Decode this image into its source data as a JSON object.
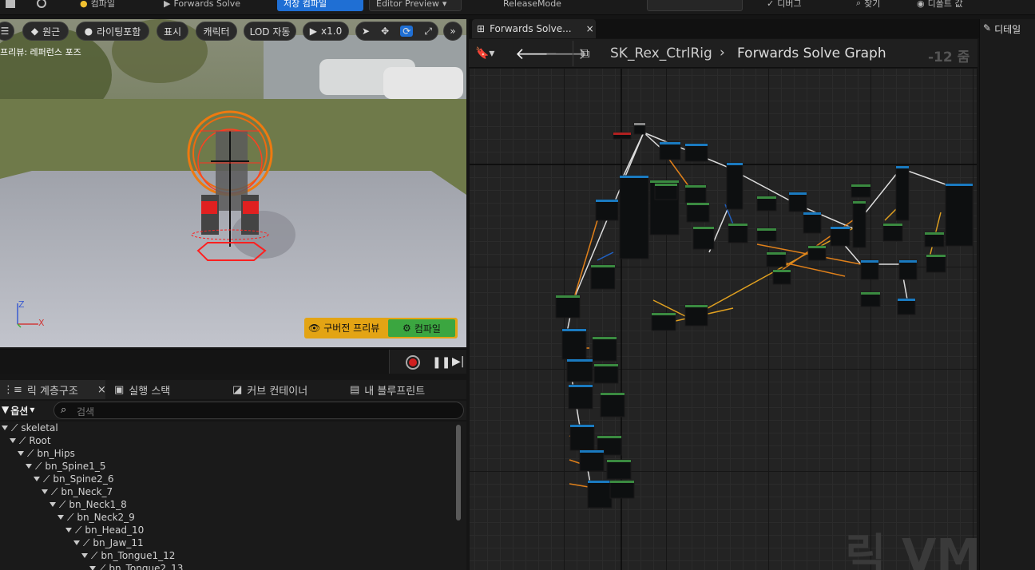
{
  "topbar": {
    "compile_label": "컴파일",
    "forwards_solve_label": "Forwards Solve",
    "save_compile_label": "저장 컴파일",
    "editor_preview_label": "Editor Preview",
    "release_mode_label": "ReleaseMode",
    "find_label": "찾기",
    "default_label": "디폴트 값",
    "debug_label": "디버그"
  },
  "viewport": {
    "toolbar": {
      "perspective_label": "원근",
      "lighting_label": "라이팅포함",
      "show_label": "표시",
      "character_label": "캐릭터",
      "lod_label": "LOD 자동",
      "speed_label": "x1.0"
    },
    "preview_label": "프리뷰: 레퍼런스 포즈",
    "axis_z": "Z",
    "axis_x": "X",
    "stale_preview_label": "구버전 프리뷰",
    "compile_button_label": "컴파일"
  },
  "tabs": {
    "rig_hierarchy": "릭 계층구조",
    "execution_stack": "실행 스택",
    "curve_container": "커브 컨테이너",
    "my_blueprint": "내 블루프린트"
  },
  "search": {
    "options_label": "옵션",
    "placeholder": "검색"
  },
  "tree": [
    {
      "label": "skeletal",
      "depth": 0
    },
    {
      "label": "Root",
      "depth": 1
    },
    {
      "label": "bn_Hips",
      "depth": 2
    },
    {
      "label": "bn_Spine1_5",
      "depth": 3
    },
    {
      "label": "bn_Spine2_6",
      "depth": 4
    },
    {
      "label": "bn_Neck_7",
      "depth": 5
    },
    {
      "label": "bn_Neck1_8",
      "depth": 6
    },
    {
      "label": "bn_Neck2_9",
      "depth": 7
    },
    {
      "label": "bn_Head_10",
      "depth": 8
    },
    {
      "label": "bn_Jaw_11",
      "depth": 9
    },
    {
      "label": "bn_Tongue1_12",
      "depth": 10
    },
    {
      "label": "bn_Tongue2_13",
      "depth": 11
    }
  ],
  "graph": {
    "tab_label": "Forwards Solve...",
    "breadcrumb_root": "SK_Rex_CtrlRig",
    "breadcrumb_current": "Forwards Solve Graph",
    "zoom_label": "-12 줌",
    "watermark": "릭 VM"
  },
  "details": {
    "label": "디테일"
  }
}
